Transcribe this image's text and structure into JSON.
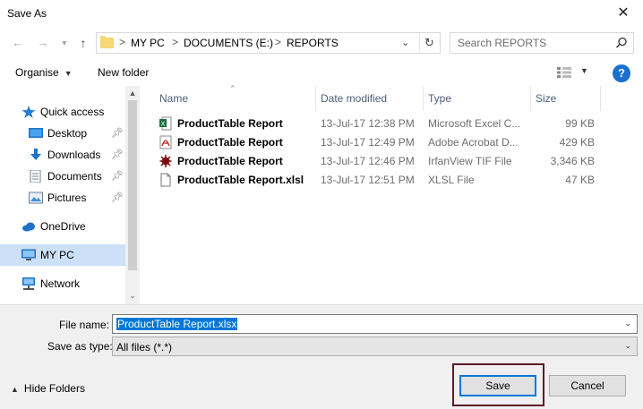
{
  "window": {
    "title": "Save As",
    "close_label": "✕"
  },
  "nav": {
    "breadcrumbs": [
      "MY PC",
      "DOCUMENTS (E:)",
      "REPORTS"
    ],
    "separator": ">",
    "search_placeholder": "Search REPORTS"
  },
  "toolbar": {
    "organise_label": "Organise",
    "new_folder_label": "New folder",
    "help_label": "?"
  },
  "sidebar": {
    "items": [
      {
        "label": "Quick access",
        "icon": "star-icon"
      },
      {
        "label": "Desktop",
        "icon": "desktop-icon",
        "pinned": true
      },
      {
        "label": "Downloads",
        "icon": "download-icon",
        "pinned": true
      },
      {
        "label": "Documents",
        "icon": "document-icon",
        "pinned": true
      },
      {
        "label": "Pictures",
        "icon": "pictures-icon",
        "pinned": true
      },
      {
        "label": "OneDrive",
        "icon": "cloud-icon"
      },
      {
        "label": "MY PC",
        "icon": "computer-icon",
        "selected": true
      },
      {
        "label": "Network",
        "icon": "network-icon"
      }
    ]
  },
  "columns": {
    "name": "Name",
    "date": "Date modified",
    "type": "Type",
    "size": "Size"
  },
  "files": [
    {
      "name": "ProductTable Report",
      "date": "13-Jul-17 12:38 PM",
      "type": "Microsoft Excel C...",
      "size": "99 KB",
      "icon": "excel-icon"
    },
    {
      "name": "ProductTable Report",
      "date": "13-Jul-17 12:49 PM",
      "type": "Adobe Acrobat D...",
      "size": "429 KB",
      "icon": "pdf-icon"
    },
    {
      "name": "ProductTable Report",
      "date": "13-Jul-17 12:46 PM",
      "type": "IrfanView TIF File",
      "size": "3,346 KB",
      "icon": "irfanview-icon"
    },
    {
      "name": "ProductTable Report.xlsl",
      "date": "13-Jul-17 12:51 PM",
      "type": "XLSL File",
      "size": "47 KB",
      "icon": "blank-file-icon"
    }
  ],
  "form": {
    "file_name_label": "File name:",
    "file_name_value": "ProductTable Report.xlsx",
    "save_type_label": "Save as type:",
    "save_type_value": "All files (*.*)"
  },
  "footer": {
    "hide_folders_label": "Hide Folders",
    "save_label": "Save",
    "cancel_label": "Cancel"
  },
  "colors": {
    "accent": "#0078d7",
    "selected_bg": "#cce0f7",
    "highlight_border": "#5e1a26",
    "header_text": "#4c607a"
  }
}
